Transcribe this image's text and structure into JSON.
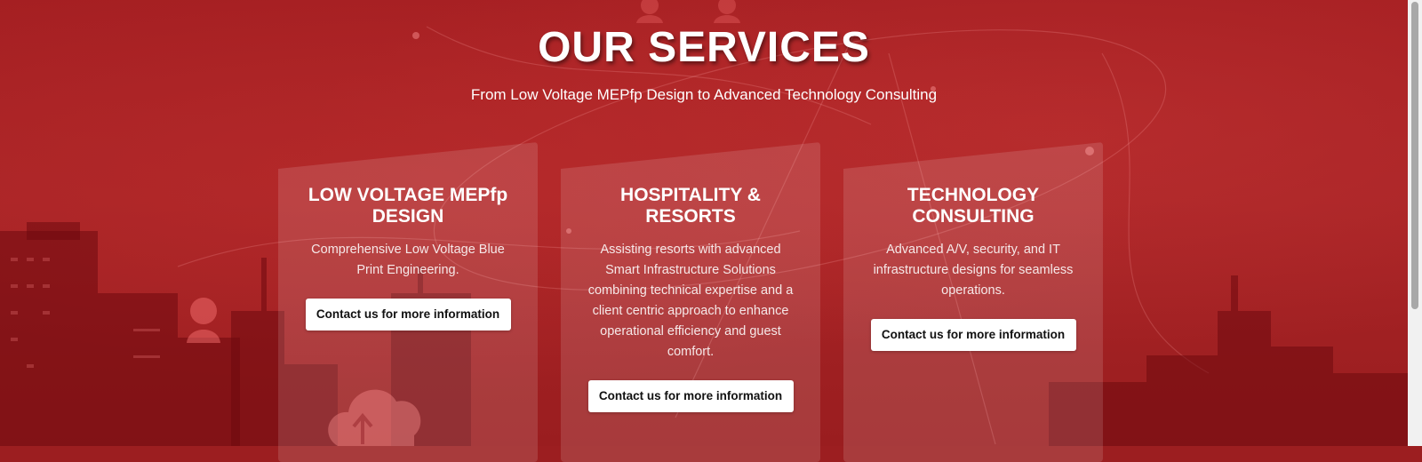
{
  "header": {
    "title": "OUR SERVICES",
    "subtitle": "From Low Voltage MEPfp Design to Advanced Technology Consulting"
  },
  "services": [
    {
      "title": "LOW VOLTAGE MEPfp DESIGN",
      "description": "Comprehensive Low Voltage Blue Print Engineering.",
      "button_label": "Contact us for more information"
    },
    {
      "title": "HOSPITALITY & RESORTS",
      "description": "Assisting resorts with advanced Smart Infrastructure Solutions combining technical expertise and a client centric approach to enhance operational efficiency and guest comfort.",
      "button_label": "Contact us for more information"
    },
    {
      "title": "TECHNOLOGY CONSULTING",
      "description": "Advanced A/V, security, and IT infrastructure designs for seamless operations.",
      "button_label": "Contact us for more information"
    }
  ],
  "colors": {
    "background": "#a51f22",
    "button_bg": "#ffffff",
    "button_text": "#111111",
    "heading_text": "#ffffff"
  },
  "icons": [
    "user-icon",
    "cloud-upload-icon"
  ]
}
